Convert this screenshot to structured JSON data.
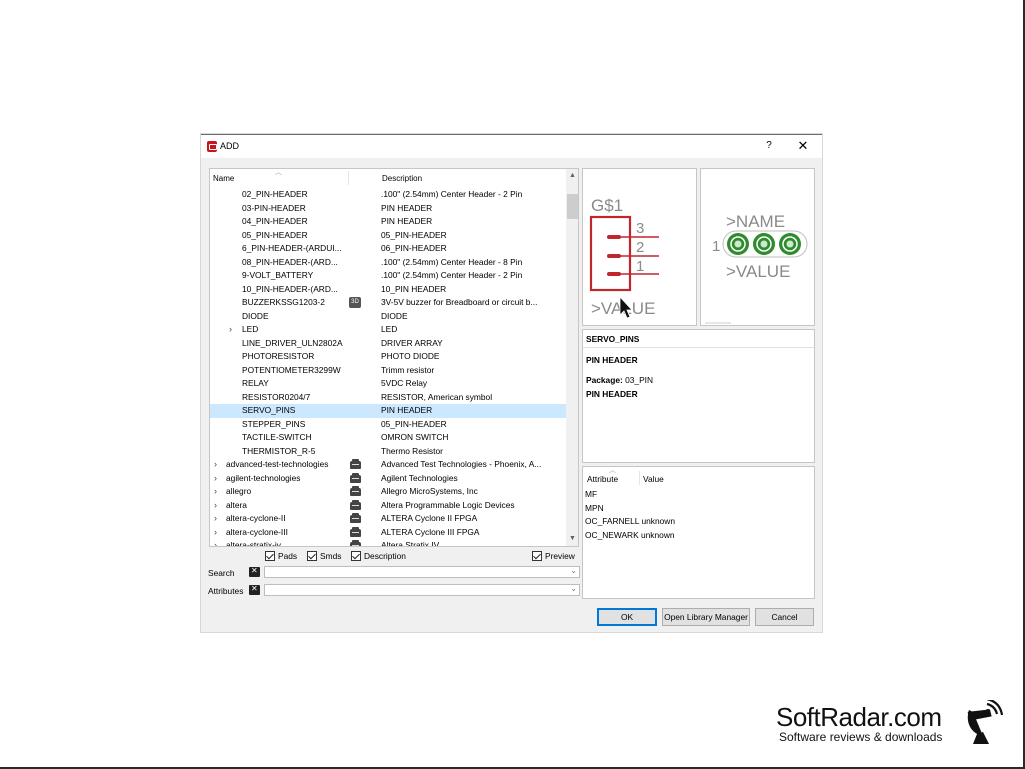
{
  "dialog": {
    "title": "ADD",
    "help_label": "?",
    "close_label": "✕"
  },
  "tree": {
    "columns": {
      "name": "Name",
      "description": "Description"
    },
    "rows": [
      {
        "kind": "comp",
        "name": "02_PIN-HEADER",
        "desc": ".100\" (2.54mm) Center Header - 2 Pin"
      },
      {
        "kind": "comp",
        "name": "03-PIN-HEADER",
        "desc": "PIN HEADER"
      },
      {
        "kind": "comp",
        "name": "04_PIN-HEADER",
        "desc": "PIN HEADER"
      },
      {
        "kind": "comp",
        "name": "05_PIN-HEADER",
        "desc": "05_PIN-HEADER"
      },
      {
        "kind": "comp",
        "name": "6_PIN-HEADER-(ARDUI...",
        "desc": "06_PIN-HEADER"
      },
      {
        "kind": "comp",
        "name": "08_PIN-HEADER-(ARD...",
        "desc": ".100\" (2.54mm) Center Header - 8 Pin"
      },
      {
        "kind": "comp",
        "name": "9-VOLT_BATTERY",
        "desc": ".100\" (2.54mm) Center Header - 2 Pin"
      },
      {
        "kind": "comp",
        "name": "10_PIN-HEADER-(ARD...",
        "desc": "10_PIN HEADER"
      },
      {
        "kind": "comp",
        "name": "BUZZERKSSG1203-2",
        "desc": "3V-5V buzzer for Breadboard or circuit b...",
        "badge": "3D"
      },
      {
        "kind": "comp",
        "name": "DIODE",
        "desc": "DIODE"
      },
      {
        "kind": "comp",
        "name": "LED",
        "desc": "LED",
        "expandable": true
      },
      {
        "kind": "comp",
        "name": "LINE_DRIVER_ULN2802A",
        "desc": "DRIVER ARRAY"
      },
      {
        "kind": "comp",
        "name": "PHOTORESISTOR",
        "desc": "PHOTO DIODE"
      },
      {
        "kind": "comp",
        "name": "POTENTIOMETER3299W",
        "desc": "Trimm resistor"
      },
      {
        "kind": "comp",
        "name": "RELAY",
        "desc": "5VDC Relay"
      },
      {
        "kind": "comp",
        "name": "RESISTOR0204/7",
        "desc": "RESISTOR, American symbol"
      },
      {
        "kind": "comp",
        "name": "SERVO_PINS",
        "desc": "PIN HEADER",
        "selected": true
      },
      {
        "kind": "comp",
        "name": "STEPPER_PINS",
        "desc": "05_PIN-HEADER"
      },
      {
        "kind": "comp",
        "name": "TACTILE-SWITCH",
        "desc": "OMRON SWITCH"
      },
      {
        "kind": "comp",
        "name": "THERMISTOR_R-5",
        "desc": "Thermo Resistor"
      },
      {
        "kind": "lib",
        "name": "advanced-test-technologies",
        "desc": "Advanced Test Technologies - Phoenix, A..."
      },
      {
        "kind": "lib",
        "name": "agilent-technologies",
        "desc": "Agilent Technologies"
      },
      {
        "kind": "lib",
        "name": "allegro",
        "desc": "Allegro MicroSystems, Inc"
      },
      {
        "kind": "lib",
        "name": "altera",
        "desc": "Altera Programmable Logic Devices"
      },
      {
        "kind": "lib",
        "name": "altera-cyclone-II",
        "desc": "ALTERA Cyclone II FPGA"
      },
      {
        "kind": "lib",
        "name": "altera-cyclone-III",
        "desc": "ALTERA Cyclone III FPGA"
      },
      {
        "kind": "lib",
        "name": "altera-stratix-iv",
        "desc": "Altera Stratix IV"
      }
    ]
  },
  "options": {
    "pads": "Pads",
    "smds": "Smds",
    "description": "Description",
    "preview": "Preview"
  },
  "search": {
    "label": "Search",
    "value": ""
  },
  "attributes_filter": {
    "label": "Attributes",
    "value": ""
  },
  "symbol_preview": {
    "name_label": "G$1",
    "pins": [
      "3",
      "2",
      "1"
    ],
    "value_label": ">VALUE"
  },
  "package_preview": {
    "name_label": ">NAME",
    "value_label": ">VALUE",
    "pin_one": "1"
  },
  "info": {
    "title": "SERVO_PINS",
    "description": "PIN HEADER",
    "package_label": "Package:",
    "package_value": "03_PIN",
    "description2": "PIN HEADER"
  },
  "attributes": {
    "col_attribute": "Attribute",
    "col_value": "Value",
    "rows": [
      "MF",
      "MPN",
      "OC_FARNELL unknown",
      "OC_NEWARK unknown"
    ]
  },
  "buttons": {
    "ok": "OK",
    "open_library_manager": "Open Library Manager",
    "cancel": "Cancel"
  },
  "watermark": {
    "title": "SoftRadar.com",
    "subtitle": "Software reviews & downloads"
  },
  "colors": {
    "selection": "#cce8ff",
    "symbol_red": "#c0272d",
    "pad_green": "#2e8b2e"
  }
}
